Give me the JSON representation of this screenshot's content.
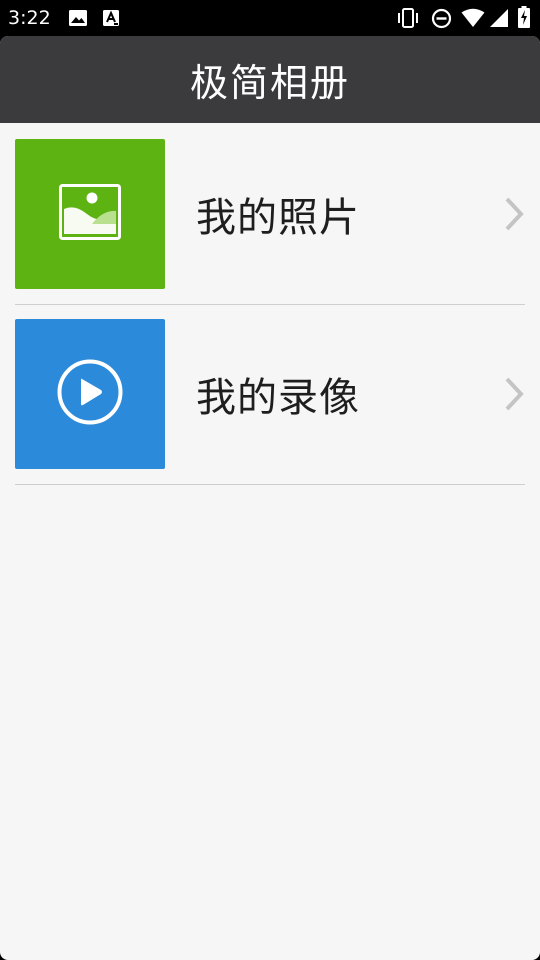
{
  "status_bar": {
    "time": "3:22",
    "left_icons": [
      "image-icon",
      "text-a-icon"
    ],
    "right_icons": [
      "vibrate-icon",
      "do-not-disturb-icon",
      "wifi-icon",
      "signal-icon",
      "battery-charging-icon"
    ]
  },
  "app": {
    "title": "极简相册"
  },
  "items": [
    {
      "label": "我的照片",
      "icon": "photo-icon",
      "color": "#5db312"
    },
    {
      "label": "我的录像",
      "icon": "play-circle-icon",
      "color": "#2b8ad9"
    }
  ],
  "colors": {
    "title_bar": "#3b3b3d",
    "background": "#f6f6f6",
    "divider": "#cfcfcf",
    "chevron": "#c4c4c4"
  }
}
